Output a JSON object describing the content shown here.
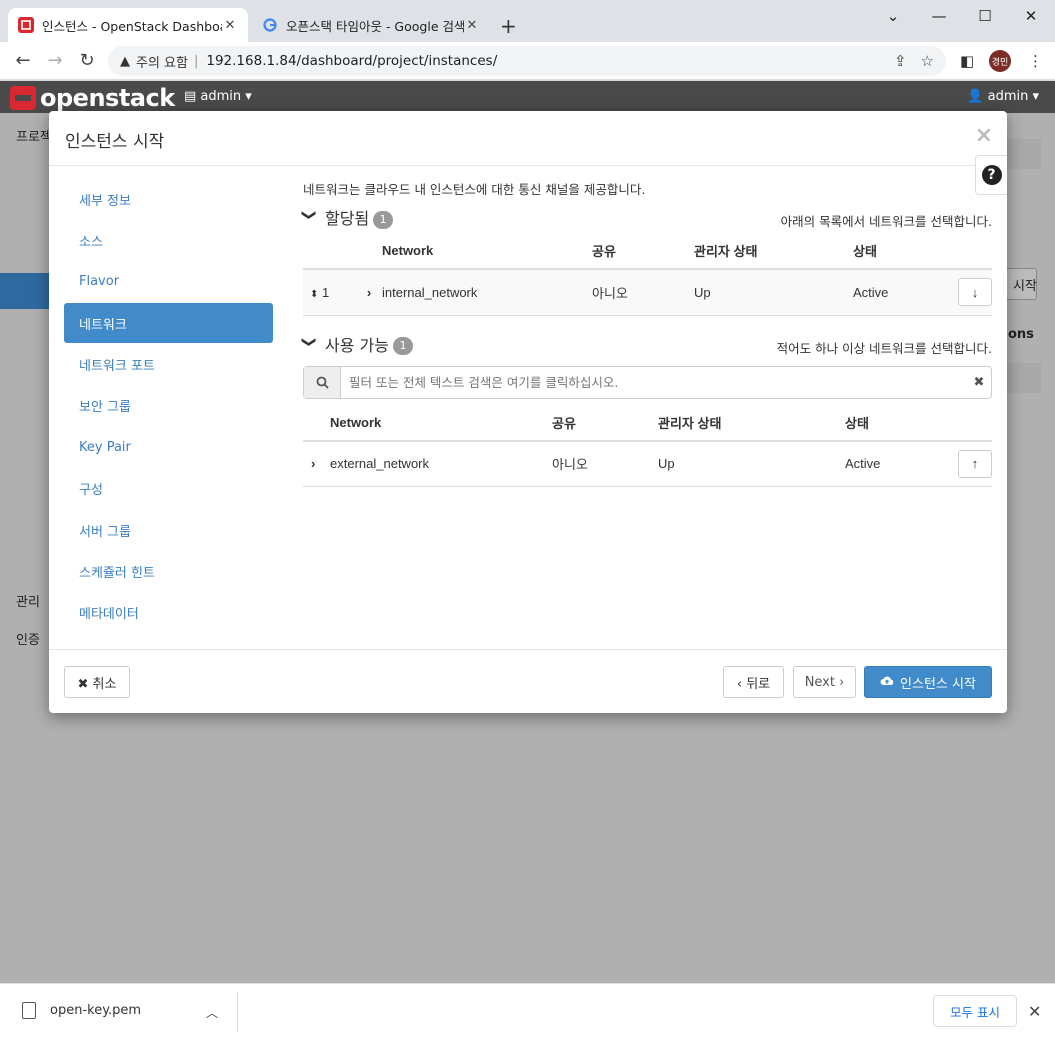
{
  "browser": {
    "tabs": [
      {
        "title": "인스턴스 - OpenStack Dashboard",
        "close": "✕"
      },
      {
        "title": "오픈스택 타임아웃 - Google 검색",
        "close": "✕"
      }
    ],
    "new_tab": "+",
    "url_warning": "주의 요함",
    "url": "192.168.1.84/dashboard/project/instances/",
    "profile_initials": "경민"
  },
  "header": {
    "logo": "openstack",
    "project": "admin ▾",
    "user": "admin ▾"
  },
  "background": {
    "left_labels": [
      "프로젝",
      "관리",
      "인증"
    ],
    "right_label_1": "시작",
    "right_label_2": "ons"
  },
  "modal": {
    "title": "인스턴스 시작",
    "close": "×",
    "help": "?",
    "nav": [
      {
        "label": "세부 정보",
        "active": false
      },
      {
        "label": "소스",
        "active": false
      },
      {
        "label": "Flavor",
        "active": false
      },
      {
        "label": "네트워크",
        "active": true
      },
      {
        "label": "네트워크 포트",
        "active": false
      },
      {
        "label": "보안 그룹",
        "active": false
      },
      {
        "label": "Key Pair",
        "active": false
      },
      {
        "label": "구성",
        "active": false
      },
      {
        "label": "서버 그룹",
        "active": false
      },
      {
        "label": "스케쥴러 힌트",
        "active": false
      },
      {
        "label": "메타데이터",
        "active": false
      }
    ],
    "intro": "네트워크는 클라우드 내 인스턴스에 대한 통신 채널을 제공합니다.",
    "allocated": {
      "title": "할당됨",
      "count": "1",
      "hint": "아래의 목록에서 네트워크를 선택합니다.",
      "columns": [
        "Network",
        "공유",
        "관리자 상태",
        "상태"
      ],
      "rows": [
        {
          "order": "1",
          "network": "internal_network",
          "shared": "아니오",
          "admin_state": "Up",
          "status": "Active"
        }
      ]
    },
    "available": {
      "title": "사용 가능",
      "count": "1",
      "hint": "적어도 하나 이상 네트워크를 선택합니다.",
      "filter_placeholder": "필터 또는 전체 텍스트 검색은 여기를 클릭하십시오.",
      "columns": [
        "Network",
        "공유",
        "관리자 상태",
        "상태"
      ],
      "rows": [
        {
          "network": "external_network",
          "shared": "아니오",
          "admin_state": "Up",
          "status": "Active"
        }
      ]
    },
    "footer": {
      "cancel": "✖ 취소",
      "back": "‹ 뒤로",
      "next": "Next ›",
      "launch": "인스턴스 시작"
    }
  },
  "download_bar": {
    "filename": "open-key.pem",
    "show_all": "모두 표시"
  },
  "colors": {
    "accent": "#428bca",
    "header": "#4a4a4a",
    "brand_red": "#d9282f"
  }
}
